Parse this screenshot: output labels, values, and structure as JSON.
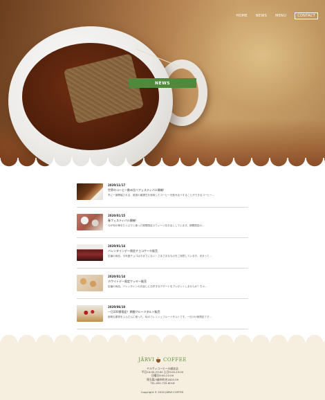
{
  "nav": {
    "items": [
      "HOME",
      "NEWS",
      "MENU"
    ],
    "contact": "CONTACT"
  },
  "hero": {
    "title": "NEWS"
  },
  "news": [
    {
      "date": "2020/11/17",
      "title": "世界のコーヒー飲み比べフェスティバル開催！",
      "text": "冬に一度開催される、各国の厳選豆を使用したコーヒーを飲み比べすることができるコーヒー…"
    },
    {
      "date": "2020/01/15",
      "title": "春フェスティバル開催！",
      "text": "今が旬の苺をたっぷりと使った期間限定スウィーツをお出ししています。期間限定の…"
    },
    {
      "date": "2020/01/14",
      "title": "バレンタインデー限定チョコケーキ販売",
      "text": "定番の商品、今年度チョコは今までにない！さまざまなものをご用意しています。決まって…"
    },
    {
      "date": "2020/01/14",
      "title": "ホワイトデー限定クッキー販売",
      "text": "定番の商品、バレンタインのお返しにお好きなデザートをプレゼントしませんか？ちゃ…"
    },
    {
      "date": "2020/06/10",
      "title": "一日100食限定！期間フルーツタルト販売",
      "text": "新鮮な果物をふんだんに使った、旬のフレッシュフルーツタルトです。一日100食限定です…"
    }
  ],
  "footer": {
    "logo_left": "JÄRVI",
    "logo_right": "COFFEE",
    "address_lines": [
      "ヤルヴィコーヒー川越支店",
      "平日10:00-23:00 土日9:00-23:00",
      "日曜日9:00-22:00",
      "埼玉県川越市町名1820-59",
      "TEL:092-725-6018"
    ],
    "copyright": "Copyright © 2020 JÄRVI COFFEE."
  }
}
